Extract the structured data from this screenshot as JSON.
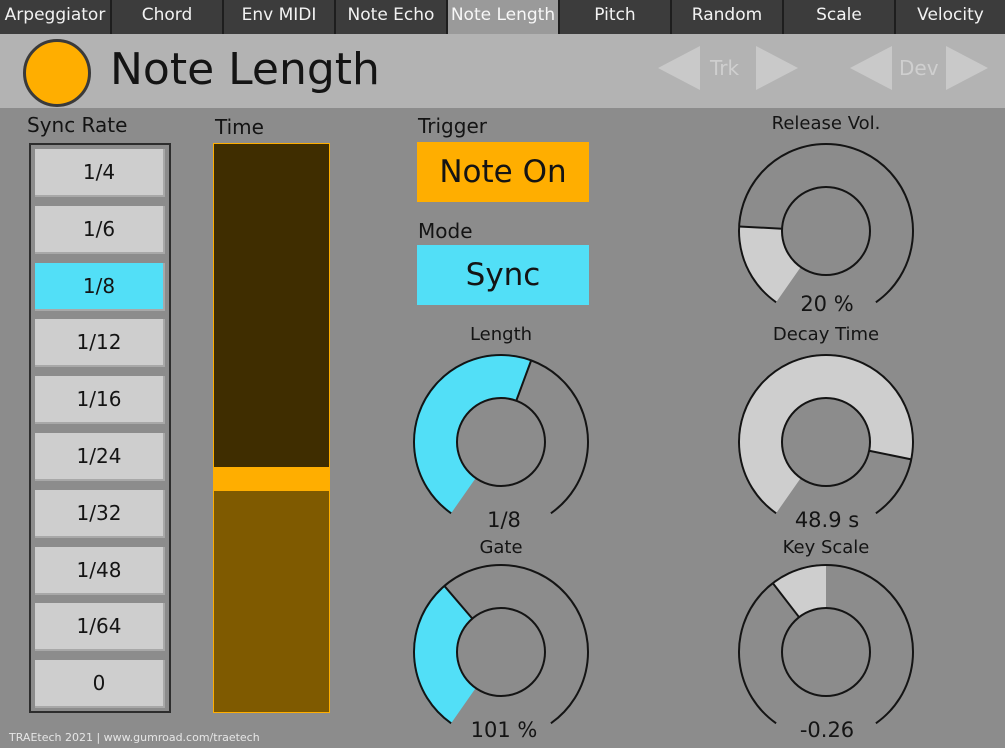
{
  "tabs": [
    {
      "label": "Arpeggiator",
      "active": false
    },
    {
      "label": "Chord",
      "active": false
    },
    {
      "label": "Env MIDI",
      "active": false
    },
    {
      "label": "Note Echo",
      "active": false
    },
    {
      "label": "Note Length",
      "active": true
    },
    {
      "label": "Pitch",
      "active": false
    },
    {
      "label": "Random",
      "active": false
    },
    {
      "label": "Scale",
      "active": false
    },
    {
      "label": "Velocity",
      "active": false
    }
  ],
  "header": {
    "title": "Note Length",
    "trk_label": "Trk",
    "dev_label": "Dev"
  },
  "sync_rate": {
    "label": "Sync Rate",
    "options": [
      "1/4",
      "1/6",
      "1/8",
      "1/12",
      "1/16",
      "1/24",
      "1/32",
      "1/48",
      "1/64",
      "0"
    ],
    "selected": "1/8"
  },
  "time": {
    "label": "Time",
    "level": 0.41
  },
  "trigger": {
    "label": "Trigger",
    "value": "Note On"
  },
  "mode": {
    "label": "Mode",
    "value": "Sync"
  },
  "knobs": {
    "length": {
      "label": "Length",
      "value": "1/8",
      "fraction": 0.57
    },
    "gate": {
      "label": "Gate",
      "value": "101 %",
      "fraction": 0.36
    },
    "release_vol": {
      "label": "Release Vol.",
      "value": "20 %",
      "fraction": 0.2
    },
    "decay_time": {
      "label": "Decay Time",
      "value": "48.9 s",
      "fraction": 0.85
    },
    "key_scale": {
      "label": "Key Scale",
      "value": "-0.26",
      "fraction": 0.37,
      "bipolar": true
    }
  },
  "colors": {
    "accent_orange": "#ffae00",
    "accent_cyan": "#52dff7",
    "track": "#141414",
    "light_fill": "#cecece"
  },
  "footer": {
    "text": "TRAEtech 2021  |  www.gumroad.com/traetech"
  }
}
